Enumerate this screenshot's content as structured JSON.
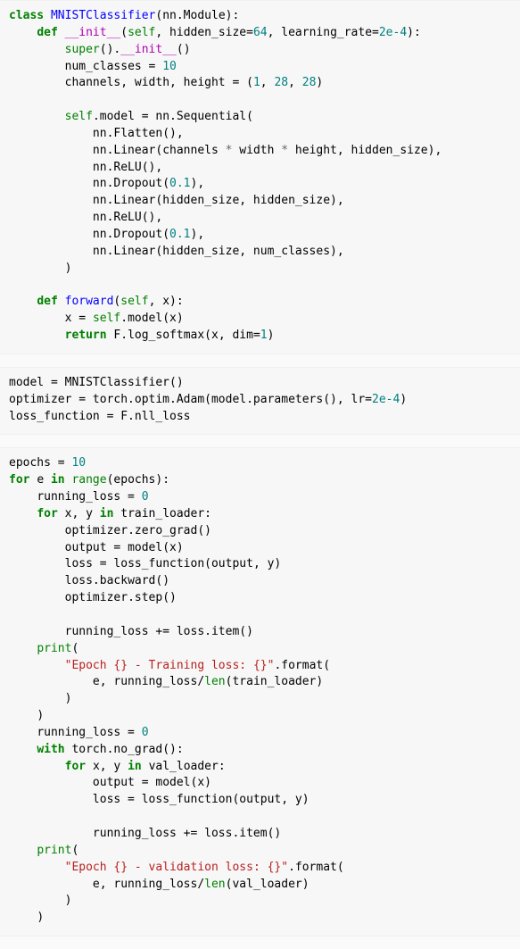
{
  "cell1": {
    "l1": {
      "class": "class ",
      "name": "MNISTClassifier",
      "rest": "(nn.Module):"
    },
    "l2": {
      "def": "def ",
      "dunder": "__init__",
      "args_open": "(",
      "self": "self",
      "args_rest": ", hidden_size=",
      "kw64": "64",
      "args_rest2": ", learning_rate=",
      "lr": "2e-4",
      "args_close": "):"
    },
    "l3a": "super",
    "l3b": "().",
    "l3c": "__init__",
    "l3d": "()",
    "l4a": "num_classes = ",
    "l4b": "10",
    "l5a": "channels, width, height = (",
    "l5b": "1",
    "l5c": ", ",
    "l5d": "28",
    "l5e": ", ",
    "l5f": "28",
    "l5g": ")",
    "l7a": "self",
    "l7b": ".model = nn.Sequential(",
    "l8": "nn.Flatten(),",
    "l9a": "nn.Linear(channels ",
    "l9op": "*",
    "l9b": " width ",
    "l9op2": "*",
    "l9c": " height, hidden_size),",
    "l10": "nn.ReLU(),",
    "l11a": "nn.Dropout(",
    "l11b": "0.1",
    "l11c": "),",
    "l12": "nn.Linear(hidden_size, hidden_size),",
    "l13": "nn.ReLU(),",
    "l14a": "nn.Dropout(",
    "l14b": "0.1",
    "l14c": "),",
    "l15": "nn.Linear(hidden_size, num_classes),",
    "l16": ")",
    "l18": {
      "def": "def ",
      "name": "forward",
      "args_open": "(",
      "self": "self",
      "args_rest": ", x):"
    },
    "l19a": "x = ",
    "l19b": "self",
    "l19c": ".model(x)",
    "l20a": "return ",
    "l20b": "F.log_softmax(x, dim=",
    "l20c": "1",
    "l20d": ")"
  },
  "cell2": {
    "l1": "model = MNISTClassifier()",
    "l2a": "optimizer = torch.optim.Adam(model.parameters(), lr=",
    "l2b": "2e-4",
    "l2c": ")",
    "l3": "loss_function = F.nll_loss"
  },
  "cell3": {
    "l1a": "epochs = ",
    "l1b": "10",
    "l2a": "for ",
    "l2b": "e ",
    "l2c": "in ",
    "l2d": "range",
    "l2e": "(epochs):",
    "l3a": "running_loss = ",
    "l3b": "0",
    "l4a": "for ",
    "l4b": "x, y ",
    "l4c": "in ",
    "l4d": "train_loader:",
    "l5": "optimizer.zero_grad()",
    "l6": "output = model(x)",
    "l7": "loss = loss_function(output, y)",
    "l8": "loss.backward()",
    "l9": "optimizer.step()",
    "l11": "running_loss += loss.item()",
    "l12a": "print",
    "l12b": "(",
    "l13a": "\"Epoch {} - Training loss: {}\"",
    "l13b": ".",
    "l13c": "format",
    "l13d": "(",
    "l14a": "e, running_loss/",
    "l14b": "len",
    "l14c": "(train_loader)",
    "l15": ")",
    "l16": ")",
    "l17a": "running_loss = ",
    "l17b": "0",
    "l18a": "with ",
    "l18b": "torch.no_grad():",
    "l19a": "for ",
    "l19b": "x, y ",
    "l19c": "in ",
    "l19d": "val_loader:",
    "l20": "output = model(x)",
    "l21": "loss = loss_function(output, y)",
    "l23": "running_loss += loss.item()",
    "l24a": "print",
    "l24b": "(",
    "l25a": "\"Epoch {} - validation loss: {}\"",
    "l25b": ".",
    "l25c": "format",
    "l25d": "(",
    "l26a": "e, running_loss/",
    "l26b": "len",
    "l26c": "(val_loader)",
    "l27": ")",
    "l28": ")"
  }
}
